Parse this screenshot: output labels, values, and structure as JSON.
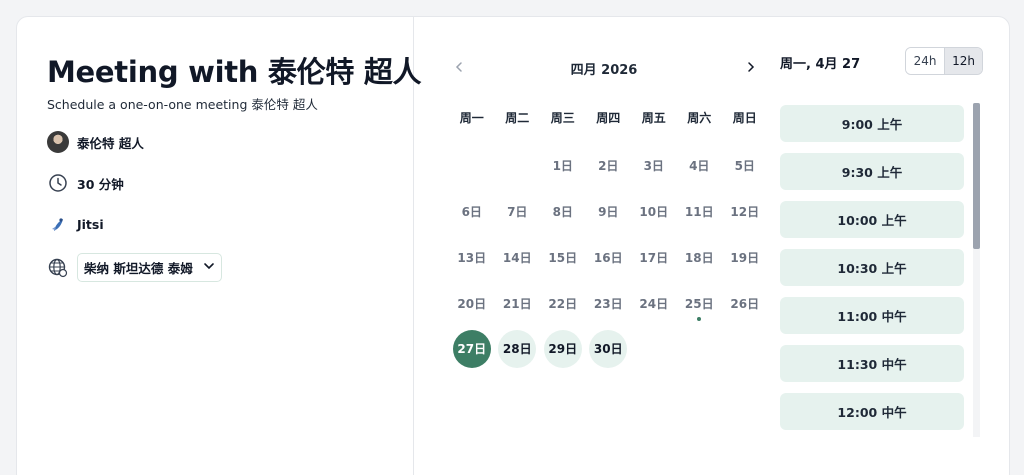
{
  "event": {
    "title": "Meeting with 泰伦特 超人",
    "subtitle": "Schedule a one-on-one meeting 泰伦特 超人",
    "host_name": "泰伦特 超人",
    "duration": "30 分钟",
    "location": "Jitsi",
    "timezone": "柴纳 斯坦达德 泰姆",
    "icons": {
      "avatar": "avatar",
      "duration": "clock-icon",
      "location": "jitsi-logo",
      "timezone": "globe-icon",
      "timezone_dropdown": "chevron-down-icon"
    }
  },
  "calendar": {
    "month_label": "四月 2026",
    "prev_icon": "chevron-left-icon",
    "next_icon": "chevron-right-icon",
    "weekdays": [
      "周一",
      "周二",
      "周三",
      "周四",
      "周五",
      "周六",
      "周日"
    ],
    "leading_blanks": 2,
    "days": [
      {
        "label": "1日",
        "state": "unavailable"
      },
      {
        "label": "2日",
        "state": "unavailable"
      },
      {
        "label": "3日",
        "state": "unavailable"
      },
      {
        "label": "4日",
        "state": "unavailable"
      },
      {
        "label": "5日",
        "state": "unavailable"
      },
      {
        "label": "6日",
        "state": "unavailable"
      },
      {
        "label": "7日",
        "state": "unavailable"
      },
      {
        "label": "8日",
        "state": "unavailable"
      },
      {
        "label": "9日",
        "state": "unavailable"
      },
      {
        "label": "10日",
        "state": "unavailable"
      },
      {
        "label": "11日",
        "state": "unavailable"
      },
      {
        "label": "12日",
        "state": "unavailable"
      },
      {
        "label": "13日",
        "state": "unavailable"
      },
      {
        "label": "14日",
        "state": "unavailable"
      },
      {
        "label": "15日",
        "state": "unavailable"
      },
      {
        "label": "16日",
        "state": "unavailable"
      },
      {
        "label": "17日",
        "state": "unavailable"
      },
      {
        "label": "18日",
        "state": "unavailable"
      },
      {
        "label": "19日",
        "state": "unavailable"
      },
      {
        "label": "20日",
        "state": "unavailable"
      },
      {
        "label": "21日",
        "state": "unavailable"
      },
      {
        "label": "22日",
        "state": "unavailable"
      },
      {
        "label": "23日",
        "state": "unavailable"
      },
      {
        "label": "24日",
        "state": "unavailable"
      },
      {
        "label": "25日",
        "state": "today"
      },
      {
        "label": "26日",
        "state": "unavailable"
      },
      {
        "label": "27日",
        "state": "selected"
      },
      {
        "label": "28日",
        "state": "available"
      },
      {
        "label": "29日",
        "state": "available"
      },
      {
        "label": "30日",
        "state": "available"
      }
    ]
  },
  "slots": {
    "date_header": "周一, 4月 27",
    "format_options": [
      "24h",
      "12h"
    ],
    "active_format": "12h",
    "times": [
      "9:00 上午",
      "9:30 上午",
      "10:00 上午",
      "10:30 上午",
      "11:00 中午",
      "11:30 中午",
      "12:00 中午"
    ]
  },
  "colors": {
    "brand": "#3d7e65",
    "available_bg": "#e6f2ee",
    "border": "#e5e7eb"
  }
}
